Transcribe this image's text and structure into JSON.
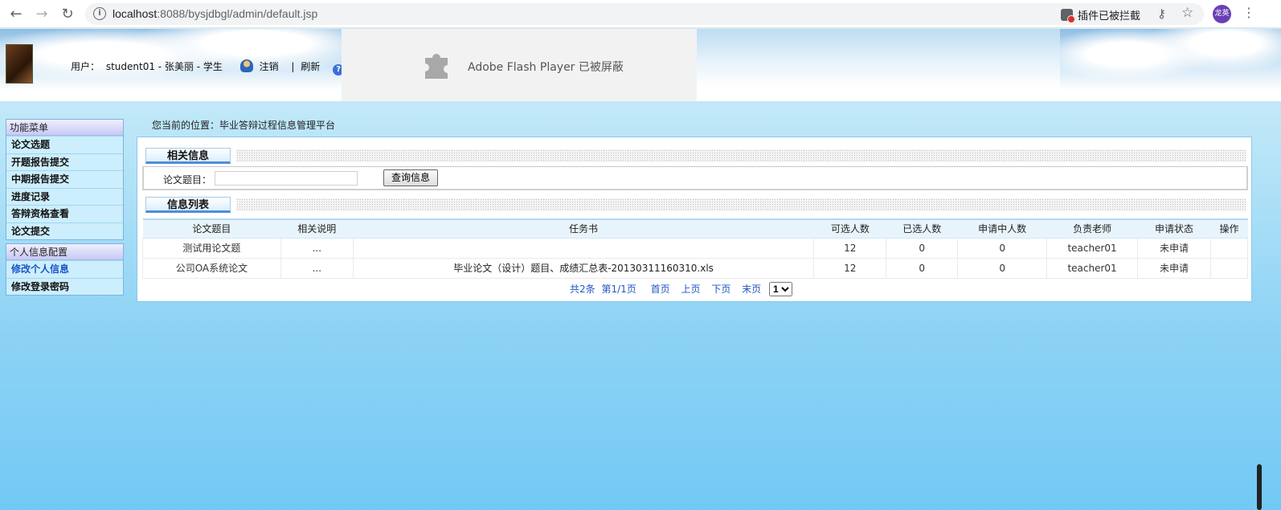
{
  "browser": {
    "url_host": "localhost",
    "url_path": ":8088/bysjdbgl/admin/default.jsp",
    "plugin_blocked": "插件已被拦截",
    "avatar_text": "龙英"
  },
  "header": {
    "user_label": "用户：",
    "user_name": "student01 - 张美丽 - 学生",
    "logout": "注销",
    "separator": "|",
    "refresh": "刷新",
    "flash_text": "Adobe Flash Player 已被屏蔽"
  },
  "sidebar": {
    "groups": [
      {
        "title": "功能菜单",
        "items": [
          "论文选题",
          "开题报告提交",
          "中期报告提交",
          "进度记录",
          "答辩资格查看",
          "论文提交"
        ]
      },
      {
        "title": "个人信息配置",
        "items": [
          "修改个人信息",
          "修改登录密码"
        ]
      }
    ]
  },
  "breadcrumb": "您当前的位置：毕业答辩过程信息管理平台",
  "search": {
    "section_title": "相关信息",
    "label": "论文题目：",
    "input_value": "",
    "button": "查询信息"
  },
  "list": {
    "section_title": "信息列表",
    "columns": [
      "论文题目",
      "相关说明",
      "任务书",
      "可选人数",
      "已选人数",
      "申请中人数",
      "负责老师",
      "申请状态",
      "操作"
    ],
    "rows": [
      [
        "测试用论文题",
        "...",
        "",
        "12",
        "0",
        "0",
        "teacher01",
        "未申请",
        ""
      ],
      [
        "公司OA系统论文",
        "...",
        "毕业论文（设计）题目、成绩汇总表-20130311160310.xls",
        "12",
        "0",
        "0",
        "teacher01",
        "未申请",
        ""
      ]
    ]
  },
  "pager": {
    "total": "共2条",
    "page": "第1/1页",
    "first": "首页",
    "prev": "上页",
    "next": "下页",
    "last": "末页",
    "selected": "1"
  },
  "colors": {
    "accent": "#4d8fd6",
    "link": "#2156c4",
    "menu_bg": "#cdeefc"
  }
}
